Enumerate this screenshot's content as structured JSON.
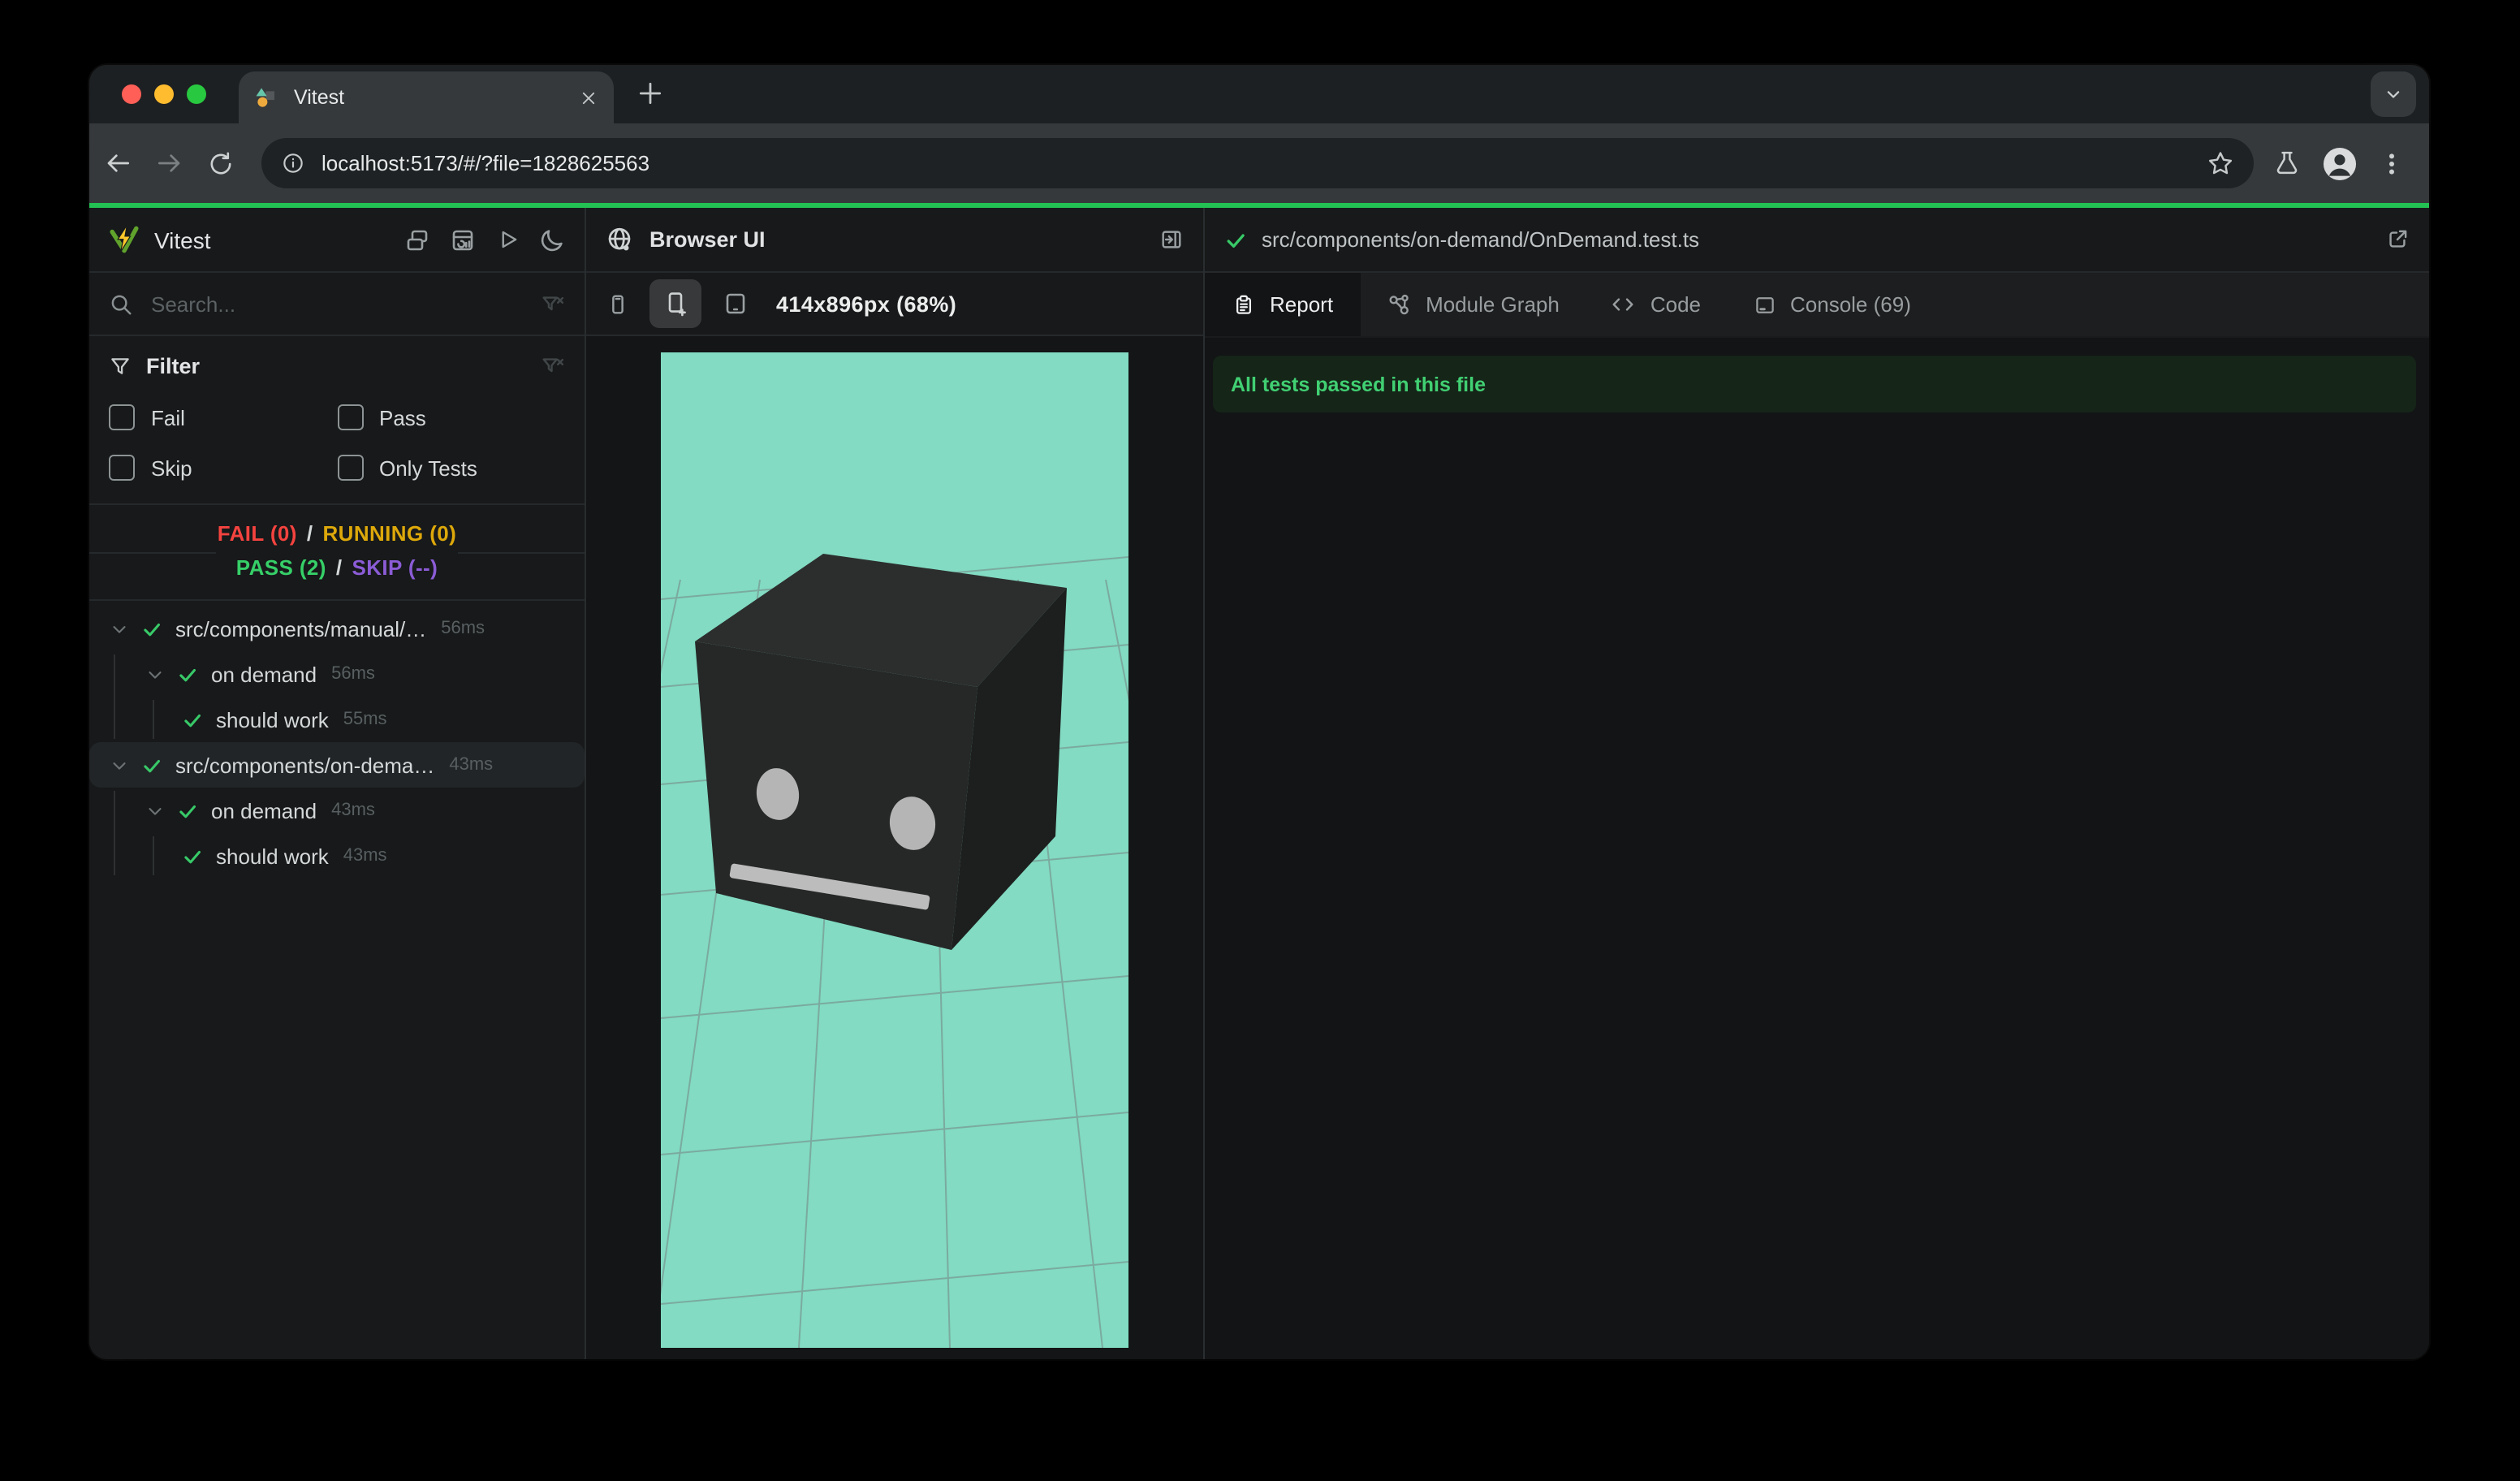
{
  "chrome": {
    "tab_title": "Vitest",
    "url": "localhost:5173/#/?file=1828625563"
  },
  "sidebar": {
    "title": "Vitest",
    "search_placeholder": "Search...",
    "filter": {
      "label": "Filter",
      "options": [
        "Fail",
        "Pass",
        "Skip",
        "Only Tests"
      ]
    },
    "status": {
      "line1": [
        {
          "text": "FAIL (0)",
          "color": "#f4433f"
        },
        {
          "text": "/",
          "color": "#d5d8d9"
        },
        {
          "text": "RUNNING (0)",
          "color": "#dda80a"
        }
      ],
      "line2": [
        {
          "text": "PASS (2)",
          "color": "#36cf68"
        },
        {
          "text": "/",
          "color": "#d5d8d9"
        },
        {
          "text": "SKIP (--)",
          "color": "#8b5cd6"
        }
      ]
    },
    "tree": [
      {
        "type": "file",
        "label": "src/components/manual/…",
        "time": "56ms",
        "selected": false
      },
      {
        "type": "suite",
        "label": "on demand",
        "time": "56ms",
        "selected": false
      },
      {
        "type": "test",
        "label": "should work",
        "time": "55ms",
        "selected": false
      },
      {
        "type": "file",
        "label": "src/components/on-dema…",
        "time": "43ms",
        "selected": true
      },
      {
        "type": "suite",
        "label": "on demand",
        "time": "43ms",
        "selected": false
      },
      {
        "type": "test",
        "label": "should work",
        "time": "43ms",
        "selected": false
      }
    ]
  },
  "browser_panel": {
    "title": "Browser UI",
    "viewport_label": "414x896px (68%)"
  },
  "report_panel": {
    "file_path": "src/components/on-demand/OnDemand.test.ts",
    "tabs": [
      {
        "label": "Report",
        "active": true
      },
      {
        "label": "Module Graph",
        "active": false
      },
      {
        "label": "Code",
        "active": false
      },
      {
        "label": "Console (69)",
        "active": false
      }
    ],
    "banner": "All tests passed in this file"
  },
  "colors": {
    "accent_green": "#23c153",
    "viewport_teal": "#82dbc2",
    "pass_green": "#36cf68",
    "fail_red": "#f4433f",
    "running_yellow": "#dda80a",
    "skip_purple": "#8b5cd6"
  }
}
